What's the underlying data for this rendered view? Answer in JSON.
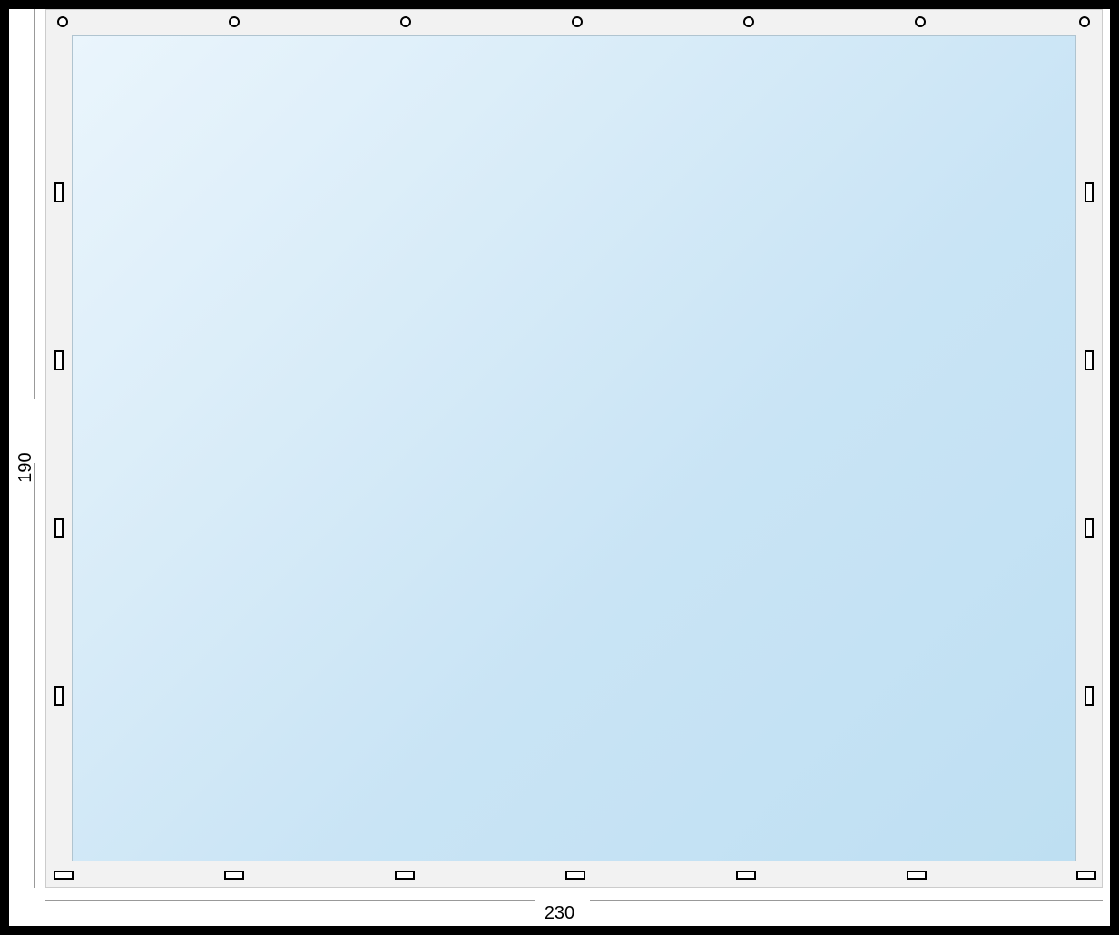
{
  "dimensions": {
    "width_label": "230",
    "height_label": "190"
  },
  "panel": {
    "top_holes": 7,
    "bottom_holes": 7,
    "left_holes": 4,
    "right_holes": 4
  }
}
